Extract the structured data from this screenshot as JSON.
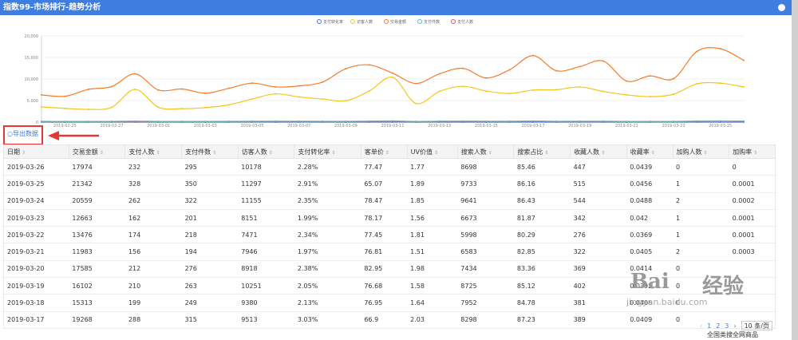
{
  "window": {
    "title": "指数99-市场排行-趋势分析"
  },
  "chart": {
    "legend": [
      {
        "label": "支付转化率",
        "color": "#3f7ee0"
      },
      {
        "label": "访客人数",
        "color": "#f5c518"
      },
      {
        "label": "交易金额",
        "color": "#f57c2b"
      },
      {
        "label": "支付件数",
        "color": "#4fc3c7"
      },
      {
        "label": "支付人数",
        "color": "#e0566b"
      }
    ],
    "y_ticks": [
      "20,000",
      "15,000",
      "10,000",
      "5,000",
      "0"
    ],
    "x_ticks": [
      "2019-02-25",
      "2019-02-27",
      "2019-03-01",
      "2019-03-03",
      "2019-03-05",
      "2019-03-07",
      "2019-03-09",
      "2019-03-11",
      "2019-03-13",
      "2019-03-15",
      "2019-03-17",
      "2019-03-19",
      "2019-03-21",
      "2019-03-23",
      "2019-03-25"
    ]
  },
  "chart_data": {
    "type": "line",
    "ylim": [
      0,
      25000
    ],
    "x": [
      "02-24",
      "02-25",
      "02-26",
      "02-27",
      "02-28",
      "03-01",
      "03-02",
      "03-03",
      "03-04",
      "03-05",
      "03-06",
      "03-07",
      "03-08",
      "03-09",
      "03-10",
      "03-11",
      "03-12",
      "03-13",
      "03-14",
      "03-15",
      "03-16",
      "03-17",
      "03-18",
      "03-19",
      "03-20",
      "03-21",
      "03-22",
      "03-23",
      "03-24",
      "03-25",
      "03-26"
    ],
    "series": [
      {
        "name": "交易金额",
        "color": "#f57c2b",
        "values": [
          7900,
          7500,
          9500,
          10300,
          14000,
          9300,
          9600,
          8400,
          9800,
          11300,
          10200,
          10500,
          11600,
          15500,
          16600,
          14200,
          11200,
          14000,
          15600,
          12800,
          15200,
          19300,
          14900,
          16100,
          17700,
          11900,
          13400,
          12600,
          20500,
          21300,
          17900
        ]
      },
      {
        "name": "访客人数",
        "color": "#f5c518",
        "values": [
          4400,
          4000,
          3700,
          4300,
          9500,
          4300,
          3900,
          4200,
          5000,
          6700,
          8200,
          7300,
          6700,
          6200,
          9000,
          13000,
          5400,
          8900,
          10400,
          9000,
          8300,
          9300,
          9400,
          10200,
          8900,
          7900,
          7400,
          8100,
          11100,
          11300,
          10200
        ]
      },
      {
        "name": "支付件数",
        "color": "#4fc3c7",
        "values": [
          230,
          210,
          200,
          220,
          300,
          210,
          200,
          210,
          230,
          260,
          280,
          270,
          250,
          240,
          300,
          340,
          220,
          280,
          300,
          270,
          260,
          315,
          249,
          263,
          276,
          194,
          218,
          201,
          322,
          350,
          295
        ]
      },
      {
        "name": "支付人数",
        "color": "#e0566b",
        "values": [
          180,
          170,
          160,
          180,
          240,
          170,
          160,
          170,
          190,
          210,
          230,
          220,
          200,
          190,
          240,
          280,
          180,
          230,
          250,
          220,
          210,
          288,
          199,
          210,
          212,
          156,
          174,
          162,
          262,
          328,
          232
        ]
      },
      {
        "name": "支付转化率",
        "color": "#3f7ee0",
        "values": [
          2,
          2,
          2,
          2,
          2,
          2,
          2,
          2,
          2,
          2,
          2,
          2,
          2,
          2,
          2,
          2,
          2,
          2,
          2,
          2,
          2,
          3,
          2,
          2,
          2,
          2,
          2,
          2,
          2,
          3,
          2
        ]
      }
    ]
  },
  "export_label": "导出数据",
  "table": {
    "headers": [
      "日期",
      "交易金额",
      "支付人数",
      "支付件数",
      "访客人数",
      "支付转化率",
      "客单价",
      "UV价值",
      "搜索人数",
      "搜索占比",
      "收藏人数",
      "收藏率",
      "加购人数",
      "加购率"
    ],
    "rows": [
      [
        "2019-03-26",
        "17974",
        "232",
        "295",
        "10178",
        "2.28%",
        "77.47",
        "1.77",
        "8698",
        "85.46",
        "447",
        "0.0439",
        "0",
        "0"
      ],
      [
        "2019-03-25",
        "21342",
        "328",
        "350",
        "11297",
        "2.91%",
        "65.07",
        "1.89",
        "9733",
        "86.16",
        "515",
        "0.0456",
        "1",
        "0.0001"
      ],
      [
        "2019-03-24",
        "20559",
        "262",
        "322",
        "11155",
        "2.35%",
        "78.47",
        "1.85",
        "9641",
        "86.43",
        "544",
        "0.0488",
        "2",
        "0.0002"
      ],
      [
        "2019-03-23",
        "12663",
        "162",
        "201",
        "8151",
        "1.99%",
        "78.17",
        "1.56",
        "6673",
        "81.87",
        "342",
        "0.042",
        "1",
        "0.0001"
      ],
      [
        "2019-03-22",
        "13476",
        "174",
        "218",
        "7471",
        "2.34%",
        "77.45",
        "1.81",
        "5998",
        "80.29",
        "276",
        "0.0369",
        "1",
        "0.0001"
      ],
      [
        "2019-03-21",
        "11983",
        "156",
        "194",
        "7946",
        "1.97%",
        "76.81",
        "1.51",
        "6583",
        "82.85",
        "322",
        "0.0405",
        "2",
        "0.0003"
      ],
      [
        "2019-03-20",
        "17585",
        "212",
        "276",
        "8918",
        "2.38%",
        "82.95",
        "1.98",
        "7434",
        "83.36",
        "369",
        "0.0414",
        "0",
        ""
      ],
      [
        "2019-03-19",
        "16102",
        "210",
        "263",
        "10251",
        "2.05%",
        "76.68",
        "1.58",
        "8725",
        "85.12",
        "402",
        "0.0392",
        "0",
        ""
      ],
      [
        "2019-03-18",
        "15313",
        "199",
        "249",
        "9380",
        "2.13%",
        "76.95",
        "1.64",
        "7952",
        "84.78",
        "381",
        "0.0406",
        "0",
        ""
      ],
      [
        "2019-03-17",
        "19268",
        "288",
        "315",
        "9513",
        "3.03%",
        "66.9",
        "2.03",
        "8298",
        "87.23",
        "389",
        "0.0409",
        "0",
        ""
      ]
    ]
  },
  "pager": {
    "prev": "‹",
    "pages": [
      "1",
      "2",
      "3"
    ],
    "next": "›",
    "page_size": "10 条/页"
  },
  "bottom_tab": "全国类搜全网商品",
  "watermark": {
    "brand": "Bai",
    "brand_cn": "经验",
    "url": "jingyan.baidu.com"
  }
}
